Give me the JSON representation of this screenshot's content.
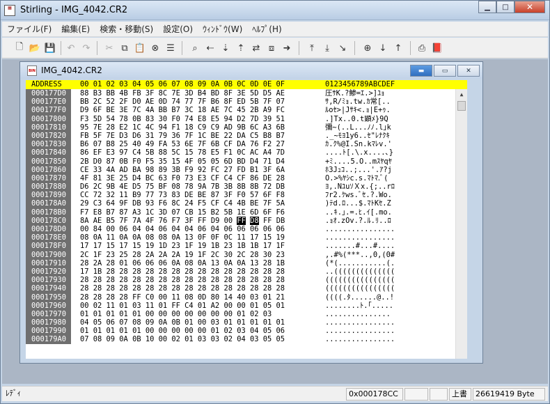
{
  "app": {
    "title": "Stirling - IMG_4042.CR2"
  },
  "menu": [
    "ファイル(F)",
    "編集(E)",
    "検索・移動(S)",
    "設定(O)",
    "ｳｨﾝﾄﾞｳ(W)",
    "ﾍﾙﾌﾟ(H)"
  ],
  "child": {
    "title": "IMG_4042.CR2"
  },
  "hex": {
    "header_address": "ADDRESS",
    "header_bytes": "00 01 02 03 04 05 06 07 08 09 0A 0B 0C 0D 0E 0F",
    "header_ascii": "0123456789ABCDEF",
    "rows": [
      {
        "a": "000177D0",
        "h": "88 B3 BB 4B FB 3F 8C 7E 3D B4 BD 8F 3E 5D D5 AE",
        "t": "圧ｻK.?鯵=ｴ.>]ﾕｮ"
      },
      {
        "a": "000177E0",
        "h": "BB 2C 52 2F D0 AE 0D 74 77 7F B6 8F ED 5B 7F 07",
        "t": "ｻ,R/ﾐｮ.tw.ｶ常[.."
      },
      {
        "a": "000177F0",
        "h": "D9 6F BE 3E 7C 4A BB B7 3C 18 AE 7C 45 2B A9 FC",
        "t": "ﾙoｾ>|Jｻｷ<.ｮ|E+ｩ."
      },
      {
        "a": "00017800",
        "h": "F3 5D 54 78 0B 83 30 F0 74 E8 E5 94 D2 7D 39 51",
        "t": ".]Tx..0.t顕ﾒ}9Q"
      },
      {
        "a": "00017810",
        "h": "95 7E 28 E2 1C 4C 94 F1 18 C9 C9 AD 9B 6C A3 6B",
        "t": "彌~(..L...ﾉﾉ.l｣k"
      },
      {
        "a": "00017820",
        "h": "FB 5F 7E D3 D6 31 79 36 7F 1C BE 22 DA C5 B8 B7",
        "t": "._~ﾓﾖ1y6..ｾ\"ﾚﾅｸｷ"
      },
      {
        "a": "00017830",
        "h": "B6 07 B8 25 40 49 FA 53 6E 7F 6B CF DA 76 F2 27",
        "t": "ｶ.ｸ%@I.Sn.kﾏﾚv.'"
      },
      {
        "a": "00017840",
        "h": "86 EF E3 97 C4 5B 88 5C 15 78 E5 F1 0C AC A4 7D",
        "t": "....ﾄ[.\\.x....､}"
      },
      {
        "a": "00017850",
        "h": "2B D0 87 0B F0 F5 35 15 4F 05 05 6D BD D4 71 D4",
        "t": "+ﾐ....5.O..mｽﾔqﾔ"
      },
      {
        "a": "00017860",
        "h": "CE 33 4A AD BA 98 89 3B F9 92 FC 27 FD B1 3F 6A",
        "t": "ﾎ3Jｭｺ..;...'.ｱ?j"
      },
      {
        "a": "00017870",
        "h": "4F 81 3E 25 D4 BC 63 F0 73 E3 CF C4 CF 86 DE 28",
        "t": "O.>%ﾔｼc.s.ﾏﾄﾏ.ﾞ("
      },
      {
        "a": "00017880",
        "h": "D6 2C 9B 4E D5 75 BF 08 78 9A 7B 3B 8B 8B 72 DB",
        "t": "ﾖ,.NﾕuｿＸx.{;..rﾛ"
      },
      {
        "a": "00017890",
        "h": "CC 72 32 11 B9 77 73 83 DE BE 87 3F F0 57 6F F8",
        "t": "ﾌr2.ｹws.ﾞｾ.?.Wo."
      },
      {
        "a": "000178A0",
        "h": "29 C3 64 9F DB 93 F6 8C 24 F5 CF C4 4B BE 7F 5A",
        "t": ")ﾃd.ﾛ...$.ﾏﾄKｾ.Z"
      },
      {
        "a": "000178B0",
        "h": "F7 E8 B7 87 A3 1C 3D 07 CB 15 B2 5B 1E 6D 6F F6",
        "t": "..ｷ.｣.=.ﾋ.ｲ[.mo."
      },
      {
        "a": "000178C0",
        "h": "8A AE B5 7F 7A 4F 76 F7 3F FF D9 00 FF D8 FF DB",
        "t": ".ｮｵ.zOv.?.ﾙ.ﾘ..ﾛ",
        "sel": [
          12,
          13
        ]
      },
      {
        "a": "000178D0",
        "h": "00 84 00 06 04 04 06 04 04 06 04 06 06 06 06 06",
        "t": "................"
      },
      {
        "a": "000178E0",
        "h": "08 0A 11 0A 0A 08 08 0A 13 0F 0F 0C 11 17 15 19",
        "t": "................"
      },
      {
        "a": "000178F0",
        "h": "17 17 15 17 15 19 1D 23 1F 19 1B 23 1B 1B 17 1F",
        "t": ".......#...#...."
      },
      {
        "a": "00017900",
        "h": "2C 1F 23 25 28 2A 2A 2A 19 1F 2C 30 2C 28 30 23",
        "t": ",.#%(***..,0,(0#"
      },
      {
        "a": "00017910",
        "h": "28 2A 28 01 06 06 06 0A 08 0A 13 0A 0A 13 28 1B",
        "t": "(*(...........(."
      },
      {
        "a": "00017920",
        "h": "17 1B 28 28 28 28 28 28 28 28 28 28 28 28 28 28",
        "t": "..(((((((((((((("
      },
      {
        "a": "00017930",
        "h": "28 28 28 28 28 28 28 28 28 28 28 28 28 28 28 28",
        "t": "(((((((((((((((("
      },
      {
        "a": "00017940",
        "h": "28 28 28 28 28 28 28 28 28 28 28 28 28 28 28 28",
        "t": "(((((((((((((((("
      },
      {
        "a": "00017950",
        "h": "28 28 28 28 FF C0 00 11 08 0D 80 14 40 03 01 21",
        "t": "((((.ﾀ......@..!"
      },
      {
        "a": "00017960",
        "h": "00 02 11 01 03 11 01 FF C4 01 A2 00 00 01 05 01",
        "t": "........ﾄ.｢....."
      },
      {
        "a": "00017970",
        "h": "01 01 01 01 01 00 00 00 00 00 00 00 01 02 03",
        "t": "..............."
      },
      {
        "a": "00017980",
        "h": "04 05 06 07 08 09 0A 0B 01 00 03 01 01 01 01 01",
        "t": "................"
      },
      {
        "a": "00017990",
        "h": "01 01 01 01 01 00 00 00 00 00 01 02 03 04 05 06",
        "t": "................"
      },
      {
        "a": "000179A0",
        "h": "07 08 09 0A 0B 10 00 02 01 03 03 02 04 03 05 05",
        "t": "................"
      }
    ]
  },
  "status": {
    "left": "ﾚﾃﾞｨ",
    "address": "0x000178CC",
    "mode": "上書",
    "size": "26619419 Byte"
  }
}
